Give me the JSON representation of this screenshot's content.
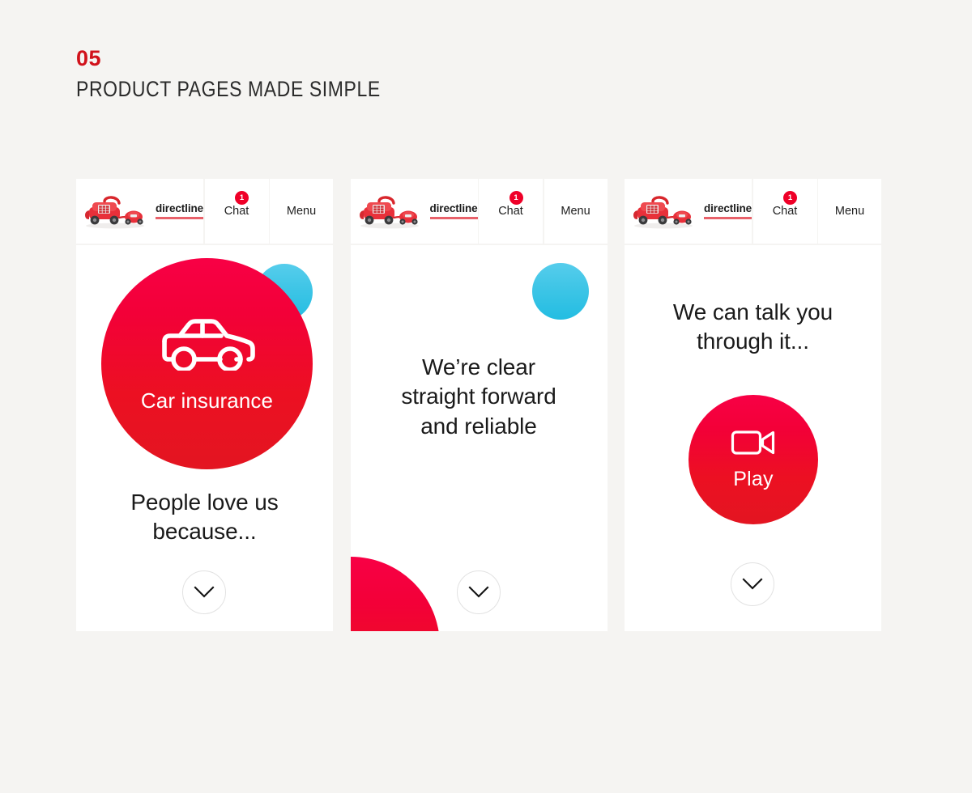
{
  "slide": {
    "number": "05",
    "title": "PRODUCT PAGES MADE SIMPLE"
  },
  "colors": {
    "page_background": "#f5f4f2",
    "brand_red": "#d1121b",
    "disc_red_top": "#f80045",
    "disc_red_bottom": "#e31521",
    "disc_cyan_top": "#56cdec",
    "disc_cyan_bottom": "#23bde2",
    "overlap_dark": "#2a0d33",
    "badge_red": "#ef0028",
    "brand_rule": "#e8616a",
    "text_dark": "#1a1a1a",
    "scroll_cue_border": "#e2e2e2"
  },
  "topbar": {
    "logo_icon": "directline-toy-telephone-logo",
    "brand_word": "directline",
    "chat_label": "Chat",
    "chat_badge_count": "1",
    "menu_label": "Menu"
  },
  "phones": [
    {
      "id": "phone-car-insurance",
      "disc": {
        "icon": "car-icon",
        "caption": "Car insurance"
      },
      "headline": "People love us\nbecause...",
      "scroll_cue_icon": "chevron-down-icon"
    },
    {
      "id": "phone-clear-straightforward",
      "headline": "We’re clear\nstraight forward\nand reliable",
      "scroll_cue_icon": "chevron-down-icon"
    },
    {
      "id": "phone-talk-you-through",
      "headline": "We can talk you\nthrough it...",
      "disc": {
        "icon": "video-camera-icon",
        "caption": "Play"
      },
      "scroll_cue_icon": "chevron-down-icon"
    }
  ]
}
